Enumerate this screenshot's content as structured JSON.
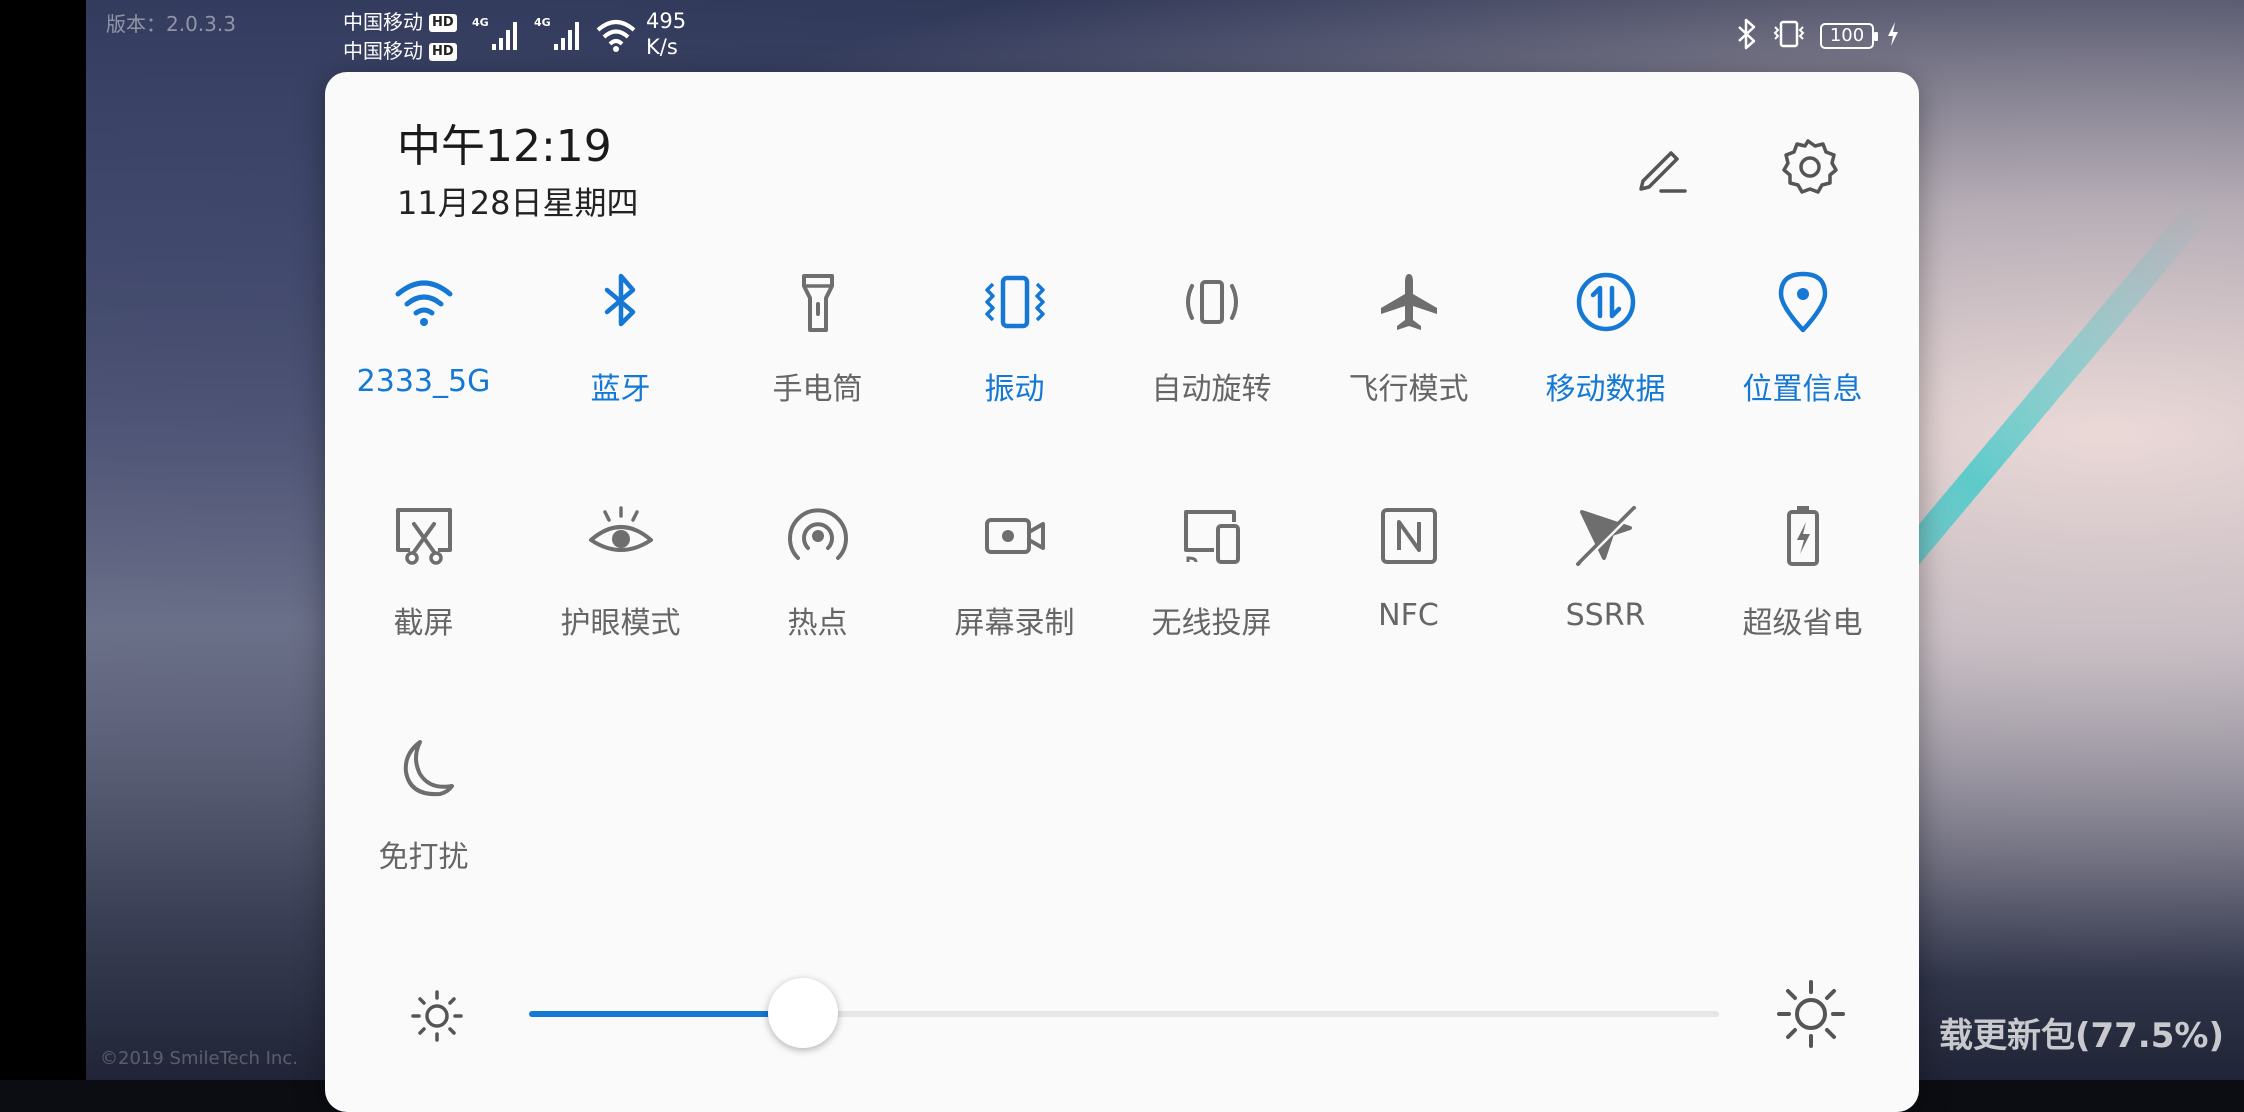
{
  "status_bar": {
    "carrier_1": "中国移动",
    "carrier_2": "中国移动",
    "hd_badge": "HD",
    "network_type": "4G",
    "net_speed_value": "495",
    "net_speed_unit": "K/s",
    "battery_level": "100"
  },
  "background": {
    "version_label": "版本：2.0.3.3",
    "copyright": "©2019 SmileTech Inc.",
    "download_progress": "载更新包(77.5%)"
  },
  "header": {
    "time": "中午12:19",
    "date": "11月28日星期四"
  },
  "tiles": [
    {
      "label": "2333_5G",
      "icon": "wifi-icon",
      "active": true
    },
    {
      "label": "蓝牙",
      "icon": "bluetooth-icon",
      "active": true
    },
    {
      "label": "手电筒",
      "icon": "flashlight-icon",
      "active": false
    },
    {
      "label": "振动",
      "icon": "vibrate-icon",
      "active": true
    },
    {
      "label": "自动旋转",
      "icon": "auto-rotate-icon",
      "active": false
    },
    {
      "label": "飞行模式",
      "icon": "airplane-icon",
      "active": false
    },
    {
      "label": "移动数据",
      "icon": "mobile-data-icon",
      "active": true
    },
    {
      "label": "位置信息",
      "icon": "location-icon",
      "active": true
    },
    {
      "label": "截屏",
      "icon": "screenshot-icon",
      "active": false
    },
    {
      "label": "护眼模式",
      "icon": "eye-comfort-icon",
      "active": false
    },
    {
      "label": "热点",
      "icon": "hotspot-icon",
      "active": false
    },
    {
      "label": "屏幕录制",
      "icon": "screen-record-icon",
      "active": false
    },
    {
      "label": "无线投屏",
      "icon": "wireless-projection-icon",
      "active": false
    },
    {
      "label": "NFC",
      "icon": "nfc-icon",
      "active": false
    },
    {
      "label": "SSRR",
      "icon": "ssrr-icon",
      "active": false
    },
    {
      "label": "超级省电",
      "icon": "super-power-saving-icon",
      "active": false
    },
    {
      "label": "免打扰",
      "icon": "do-not-disturb-icon",
      "active": false
    }
  ],
  "brightness": {
    "level": 0.23
  },
  "colors": {
    "accent": "#1478d4",
    "inactive_icon": "#6e6e6e",
    "panel_bg": "#fafafa"
  }
}
